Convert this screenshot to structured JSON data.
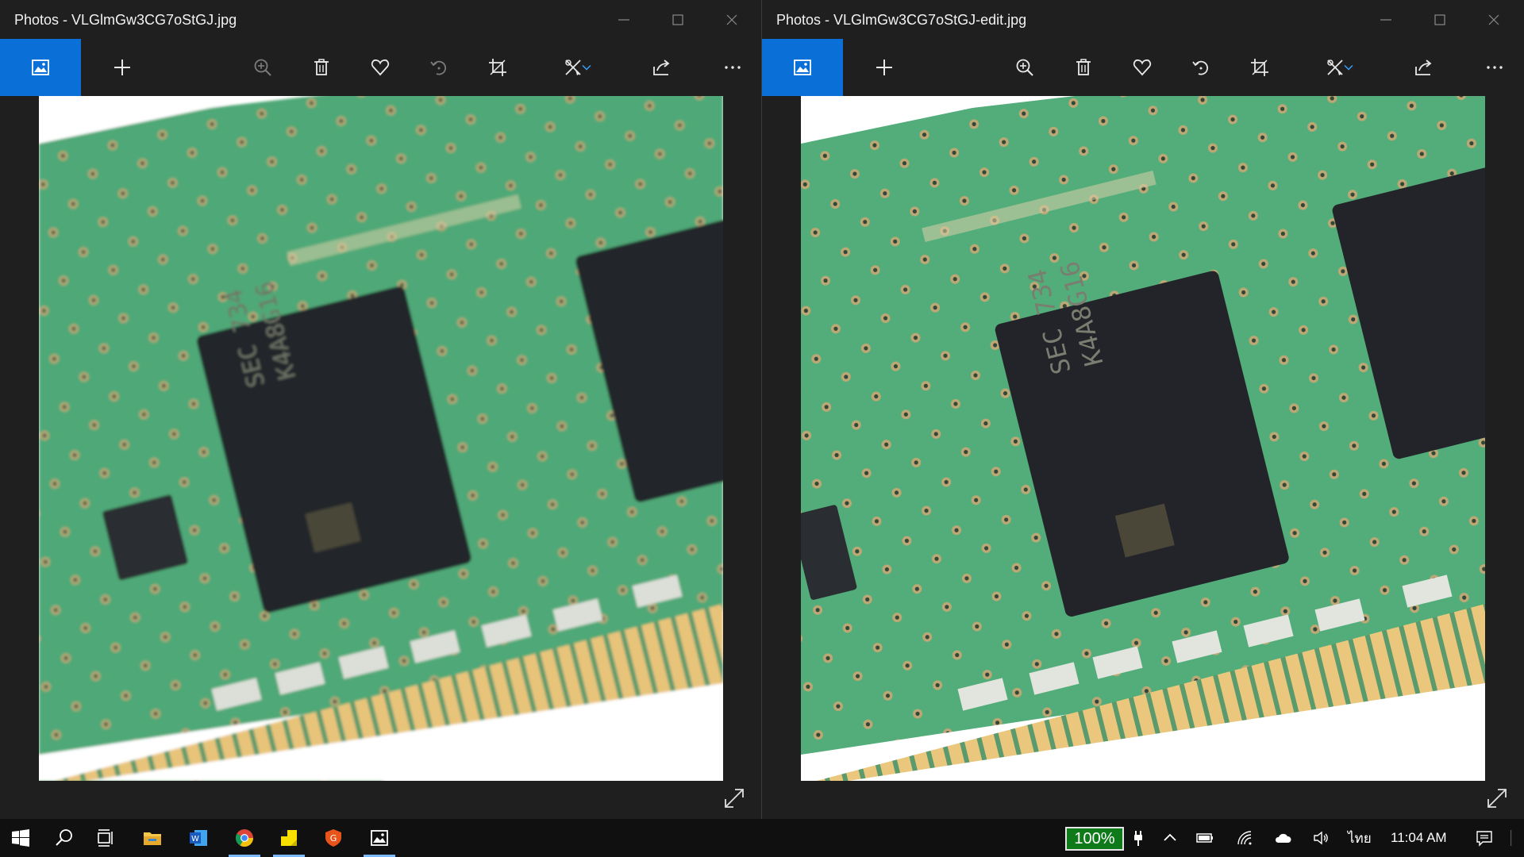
{
  "left_window": {
    "title": "Photos - VLGlmGw3CG7oStGJ.jpg",
    "toolbar": [
      {
        "name": "see-all-photos",
        "icon": "photos-icon"
      },
      {
        "name": "add-to",
        "icon": "plus-icon"
      },
      {
        "name": "zoom",
        "icon": "zoom-in-icon"
      },
      {
        "name": "delete",
        "icon": "trash-icon"
      },
      {
        "name": "favorite",
        "icon": "heart-icon"
      },
      {
        "name": "rotate",
        "icon": "rotate-icon"
      },
      {
        "name": "crop",
        "icon": "crop-icon"
      },
      {
        "name": "edit",
        "icon": "edit-icon"
      },
      {
        "name": "share",
        "icon": "share-icon"
      },
      {
        "name": "more",
        "icon": "more-icon"
      }
    ]
  },
  "right_window": {
    "title": "Photos - VLGlmGw3CG7oStGJ-edit.jpg"
  },
  "taskbar": {
    "battery_percent": "100%",
    "language": "ไทย",
    "clock": "11:04 AM",
    "apps": [
      "start",
      "search",
      "task-view",
      "file-explorer",
      "word",
      "chrome",
      "sticky-notes",
      "browser-g",
      "photos"
    ]
  },
  "colors": {
    "accent": "#0a6fd6",
    "pcb": "#4fa877",
    "chip": "#24262b",
    "gold": "#e8c47a"
  }
}
